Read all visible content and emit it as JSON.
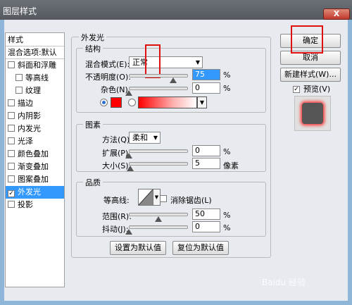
{
  "window": {
    "title": "图层样式",
    "close_label": "X"
  },
  "stylelist": {
    "header": "样式",
    "blend_item": "混合选项:默认",
    "items": [
      {
        "label": "斜面和浮雕",
        "checked": false,
        "indent": false
      },
      {
        "label": "等高线",
        "checked": false,
        "indent": true
      },
      {
        "label": "纹理",
        "checked": false,
        "indent": true
      },
      {
        "label": "描边",
        "checked": false,
        "indent": false
      },
      {
        "label": "内阴影",
        "checked": false,
        "indent": false
      },
      {
        "label": "内发光",
        "checked": false,
        "indent": false
      },
      {
        "label": "光泽",
        "checked": false,
        "indent": false
      },
      {
        "label": "颜色叠加",
        "checked": false,
        "indent": false
      },
      {
        "label": "渐变叠加",
        "checked": false,
        "indent": false
      },
      {
        "label": "图案叠加",
        "checked": false,
        "indent": false
      },
      {
        "label": "外发光",
        "checked": true,
        "indent": false,
        "selected": true
      },
      {
        "label": "投影",
        "checked": false,
        "indent": false
      }
    ]
  },
  "outer_glow": {
    "title": "外发光",
    "structure": {
      "title": "结构",
      "blend_mode_label": "混合模式(E):",
      "blend_mode_value": "正常",
      "opacity_label": "不透明度(O):",
      "opacity_value": "75",
      "noise_label": "杂色(N):",
      "noise_value": "0",
      "percent": "%"
    },
    "elements": {
      "title": "图素",
      "method_label": "方法(Q):",
      "method_value": "柔和",
      "spread_label": "扩展(P):",
      "spread_value": "0",
      "size_label": "大小(S):",
      "size_value": "5",
      "percent": "%",
      "px_unit": "像素"
    },
    "quality": {
      "title": "品质",
      "contour_label": "等高线:",
      "antialias_label": "消除锯齿(L)",
      "range_label": "范围(R):",
      "range_value": "50",
      "jitter_label": "抖动(J):",
      "jitter_value": "0",
      "percent": "%"
    },
    "make_default": "设置为默认值",
    "reset_default": "复位为默认值"
  },
  "buttons": {
    "ok": "确定",
    "cancel": "取消",
    "new_style": "新建样式(W)...",
    "preview_label": "预览(V)"
  },
  "levels": {
    "opacity": 0.75,
    "noise": 0.0,
    "spread": 0.0,
    "size": 0.02,
    "range": 0.5,
    "jitter": 0.0
  },
  "colors": {
    "glow": "#ff0000",
    "selection": "#3399ff",
    "highlight_box": "#e01010"
  },
  "watermark": "Baidu 经验"
}
